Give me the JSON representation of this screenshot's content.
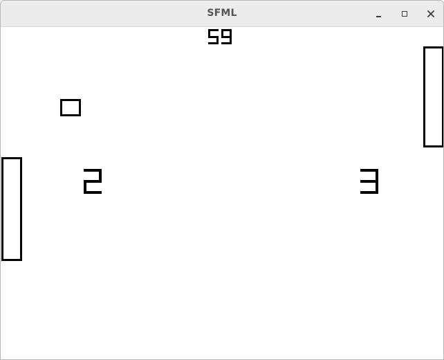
{
  "window": {
    "title": "SFML",
    "controls": {
      "minimize_icon": "minimize-icon",
      "maximize_icon": "maximize-icon",
      "close_icon": "close-icon",
      "close_glyph": "×"
    }
  },
  "game": {
    "timer": "59",
    "score_left": "2",
    "score_right": "3",
    "colors": {
      "background": "#ffffff",
      "foreground": "#000000"
    }
  }
}
